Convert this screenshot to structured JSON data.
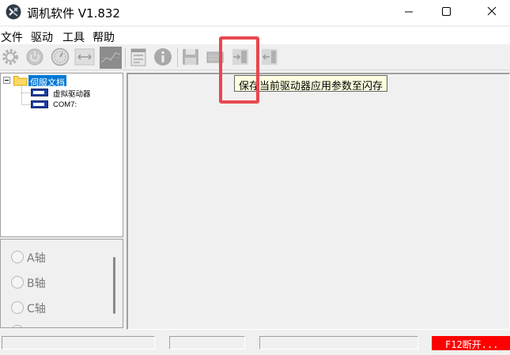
{
  "window": {
    "title": "调机软件 V1.832"
  },
  "menu": {
    "items": [
      "文件",
      "驱动",
      "工具",
      "帮助"
    ]
  },
  "toolbar": {
    "buttons": [
      {
        "name": "settings-gear-icon",
        "enabled": false
      },
      {
        "name": "power-icon",
        "enabled": false
      },
      {
        "name": "dial-gauge-icon",
        "enabled": false
      },
      {
        "name": "move-arrows-icon",
        "enabled": false
      },
      {
        "name": "oscilloscope-icon",
        "enabled": false
      },
      {
        "name": "param-log-icon",
        "enabled": false
      },
      {
        "name": "info-icon",
        "enabled": false
      },
      {
        "name": "save-icon",
        "enabled": false
      },
      {
        "name": "read-drive-icon",
        "enabled": false
      },
      {
        "name": "write-flash-icon",
        "enabled": false
      },
      {
        "name": "restore-default-icon",
        "enabled": false
      }
    ],
    "tooltip": "保存当前驱动器应用参数至闪存"
  },
  "tree": {
    "root_label": "伺服文档",
    "items": [
      {
        "label": "虚拟驱动器"
      },
      {
        "label": "COM7:"
      }
    ]
  },
  "axes": {
    "items": [
      "A轴",
      "B轴",
      "C轴"
    ]
  },
  "statusbar": {
    "connect_label": "F12断开..."
  },
  "colors": {
    "highlight": "#e8474f",
    "status_alert": "#ff0000",
    "tree_selection": "#0078d7"
  }
}
